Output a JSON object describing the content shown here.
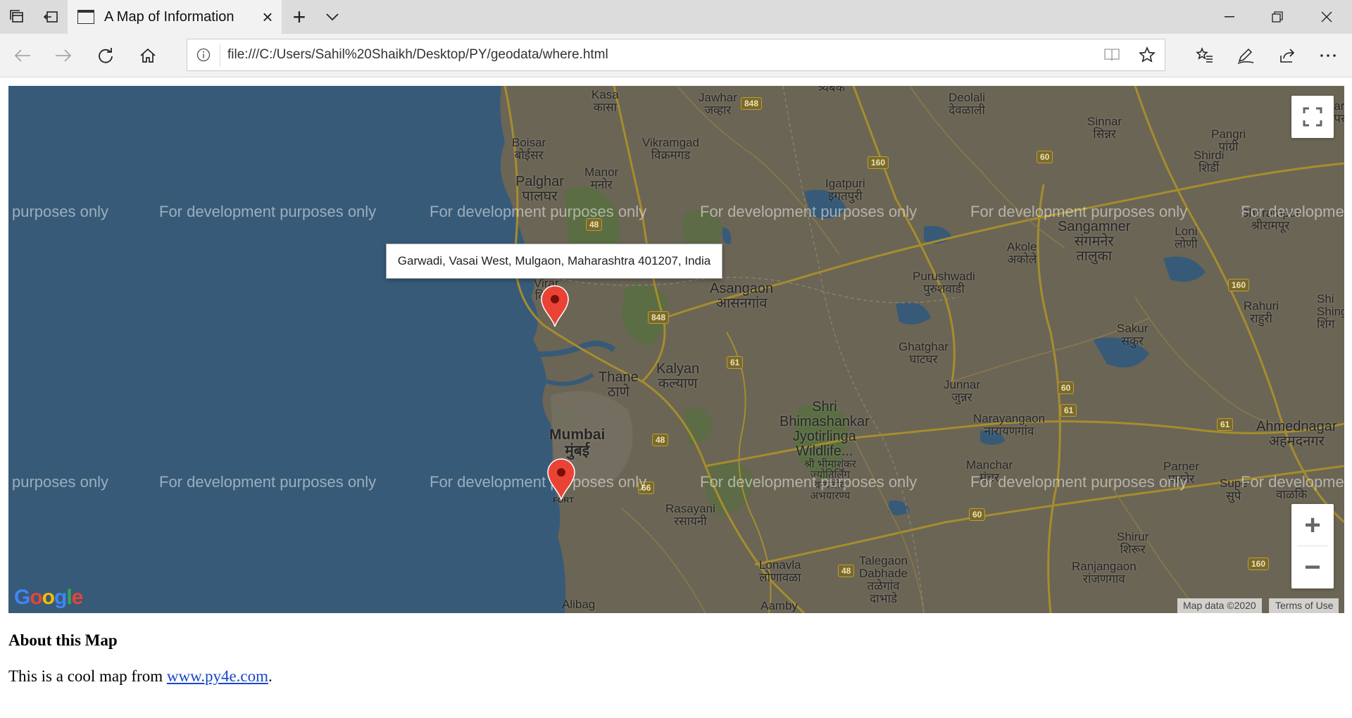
{
  "browser": {
    "tab": {
      "title": "A Map of Information"
    },
    "address_url": "file:///C:/Users/Sahil%20Shaikh/Desktop/PY/geodata/where.html"
  },
  "map": {
    "info_window_text": "Garwadi, Vasai West, Mulgaon, Maharashtra 401207, India",
    "watermark_text": "For development purposes only",
    "watermark_partial_left": "purposes only",
    "watermark_partial_right": "For developme",
    "zoom_in_label": "+",
    "zoom_out_label": "−",
    "attribution": "Map data ©2020",
    "terms": "Terms of Use",
    "logo": "Google",
    "markers": [
      {
        "name": "vasai-marker"
      },
      {
        "name": "mumbai-marker"
      }
    ],
    "places": {
      "kasa": "Kasa\nकासा",
      "jawhar": "Jawhar\nजव्हार",
      "trimbak": "त्र्यंबक",
      "deolali": "Deolali\nदेवळाली",
      "sinnar": "Sinnar\nसिन्नर",
      "pangri": "Pangri\nपांग्री",
      "kopargaon": "Kopargaon\nकोपरगांव",
      "boisar": "Boisar\nबोईसर",
      "vikramgad": "Vikramgad\nविक्रमगड",
      "manor": "Manor\nमनोर",
      "shirdi": "Shirdi\nशिर्डी",
      "palghar": "Palghar\nपालघर",
      "igatpuri": "Igatpuri\nइगतपुरी",
      "sangamner": "Sangamner\nसंगमनेर\nतालुका",
      "shrirampur": "Shrirampur\nश्रीरामपूर",
      "loni": "Loni\nलोणी",
      "akole": "Akole\nअकोले",
      "virar": "Virar\nविरार",
      "asangaon": "Asangaon\nआसनगांव",
      "purushwadi": "Purushwadi\nपुरुशवाडी",
      "rahuri": "Rahuri\nराहुरी",
      "shingnapur": "Shi\nShing\nशिंग",
      "sakur": "Sakur\nसकुर",
      "ghatghar": "Ghatghar\nघाटघर",
      "thane": "Thane\nठाणे",
      "kalyan": "Kalyan\nकल्याण",
      "junnar": "Junnar\nजुन्नर",
      "narayangaon": "Narayangaon\nनारायणगांव",
      "shri_bhimashankar": "Shri\nBhimashankar\nJyotirlinga\nWildlife...",
      "bhimashankar_marathi": "श्री भीमाशंकर\nज्योतिर्लिंग\nवन्यजीव\nअभयारण्य",
      "ahmednagar": "Ahmednagar\nअहमदनगर",
      "mumbai": "Mumbai\nमुंबई",
      "fort": "FORT",
      "manchar": "Manchar\nमंचर",
      "parner": "Parner\nपारनेर",
      "supe": "Supe\nसुपे",
      "walki": "वाळकि",
      "rasayani": "Rasayani\nरसायनी",
      "shirur": "Shirur\nशिरूर",
      "lonavla": "Lonavla\nलोणावळा",
      "talegaon": "Talegaon\nDabhade\nतळेगांव\nदाभाडे",
      "ranjangaon": "Ranjangaon\nरांजणगाव",
      "alibag": "Alibag",
      "aamby": "Aamby"
    },
    "shields": [
      "848",
      "160",
      "60",
      "48",
      "848",
      "160",
      "61",
      "60",
      "61",
      "61",
      "48",
      "66",
      "60",
      "48",
      "160"
    ]
  },
  "content": {
    "heading": "About this Map",
    "text_prefix": "This is a cool map from ",
    "link_text": "www.py4e.com",
    "text_suffix": "."
  }
}
